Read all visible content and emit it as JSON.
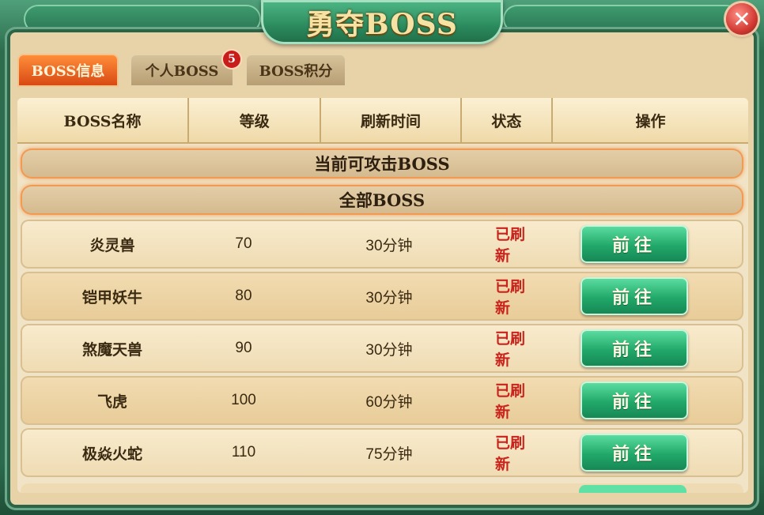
{
  "window": {
    "title": "勇夺BOSS",
    "close_symbol": "✕"
  },
  "tabs": [
    {
      "label": "BOSS信息",
      "active": true
    },
    {
      "label": "个人BOSS",
      "badge": "5"
    },
    {
      "label": "BOSS积分"
    }
  ],
  "columns": [
    "BOSS名称",
    "等级",
    "刷新时间",
    "状态",
    "操作"
  ],
  "sections": {
    "current": "当前可攻击BOSS",
    "all": "全部BOSS"
  },
  "rows": [
    {
      "name": "炎灵兽",
      "level": "70",
      "refresh": "30分钟",
      "status": "已刷新",
      "action": "前往"
    },
    {
      "name": "铠甲妖牛",
      "level": "80",
      "refresh": "30分钟",
      "status": "已刷新",
      "action": "前往"
    },
    {
      "name": "煞魔天兽",
      "level": "90",
      "refresh": "30分钟",
      "status": "已刷新",
      "action": "前往"
    },
    {
      "name": "飞虎",
      "level": "100",
      "refresh": "60分钟",
      "status": "已刷新",
      "action": "前往"
    },
    {
      "name": "极焱火蛇",
      "level": "110",
      "refresh": "75分钟",
      "status": "已刷新",
      "action": "前往"
    }
  ],
  "colors": {
    "status_red": "#c8231c",
    "button_green": "#21a869",
    "tab_active": "#d84a14"
  }
}
